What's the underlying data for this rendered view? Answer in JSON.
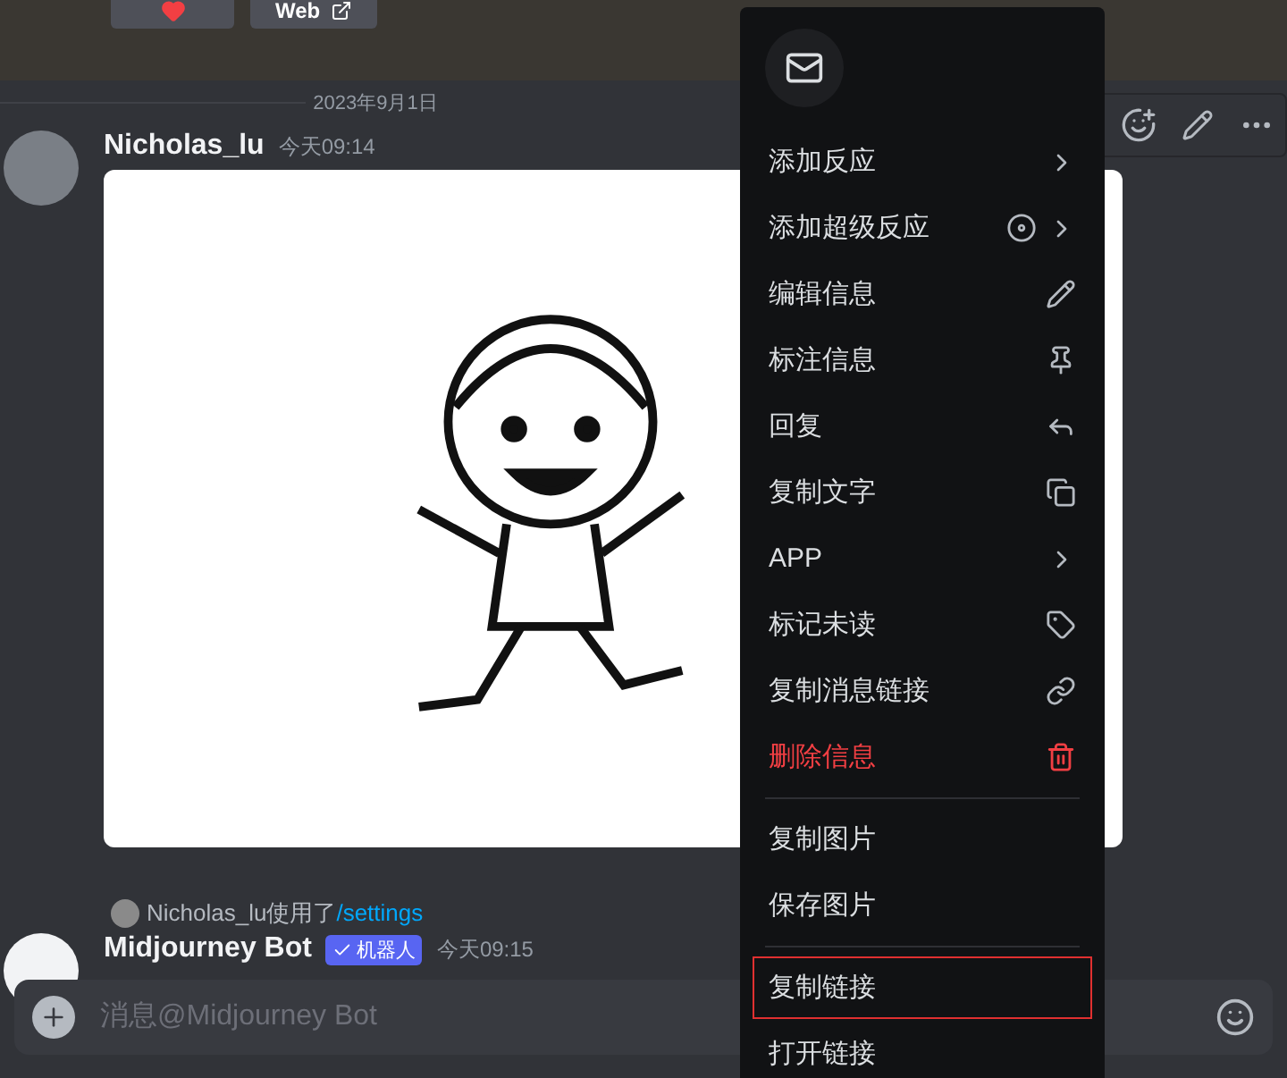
{
  "top_buttons": [
    {
      "kind": "heart"
    },
    {
      "kind": "link",
      "label": "Web"
    }
  ],
  "date_divider": "2023年9月1日",
  "messages": [
    {
      "author": "Nicholas_lu",
      "time": "今天09:14"
    },
    {
      "author": "Midjourney Bot",
      "time": "今天09:15",
      "bot_badge": "机器人",
      "reply": {
        "user": "Nicholas_lu",
        "text": "使用了",
        "command": "/settings"
      }
    }
  ],
  "input": {
    "placeholder": "消息@Midjourney Bot"
  },
  "context_menu": {
    "groups": [
      [
        {
          "label": "添加反应",
          "submenu": true,
          "danger": false,
          "highlighted": false
        },
        {
          "label": "添加超级反应",
          "submenu": true,
          "danger": false,
          "highlighted": false
        },
        {
          "label": "编辑信息",
          "submenu": false,
          "danger": false,
          "highlighted": false
        },
        {
          "label": "标注信息",
          "submenu": false,
          "danger": false,
          "highlighted": false
        },
        {
          "label": "回复",
          "submenu": false,
          "danger": false,
          "highlighted": false
        },
        {
          "label": "复制文字",
          "submenu": false,
          "danger": false,
          "highlighted": false
        },
        {
          "label": "APP",
          "submenu": true,
          "danger": false,
          "highlighted": false
        },
        {
          "label": "标记未读",
          "submenu": false,
          "danger": false,
          "highlighted": false
        },
        {
          "label": "复制消息链接",
          "submenu": false,
          "danger": false,
          "highlighted": false
        },
        {
          "label": "删除信息",
          "submenu": false,
          "danger": true,
          "highlighted": false
        }
      ],
      [
        {
          "label": "复制图片",
          "submenu": false,
          "danger": false,
          "highlighted": false
        },
        {
          "label": "保存图片",
          "submenu": false,
          "danger": false,
          "highlighted": false
        }
      ],
      [
        {
          "label": "复制链接",
          "submenu": false,
          "danger": false,
          "highlighted": true
        },
        {
          "label": "打开链接",
          "submenu": false,
          "danger": false,
          "highlighted": false
        }
      ]
    ]
  }
}
